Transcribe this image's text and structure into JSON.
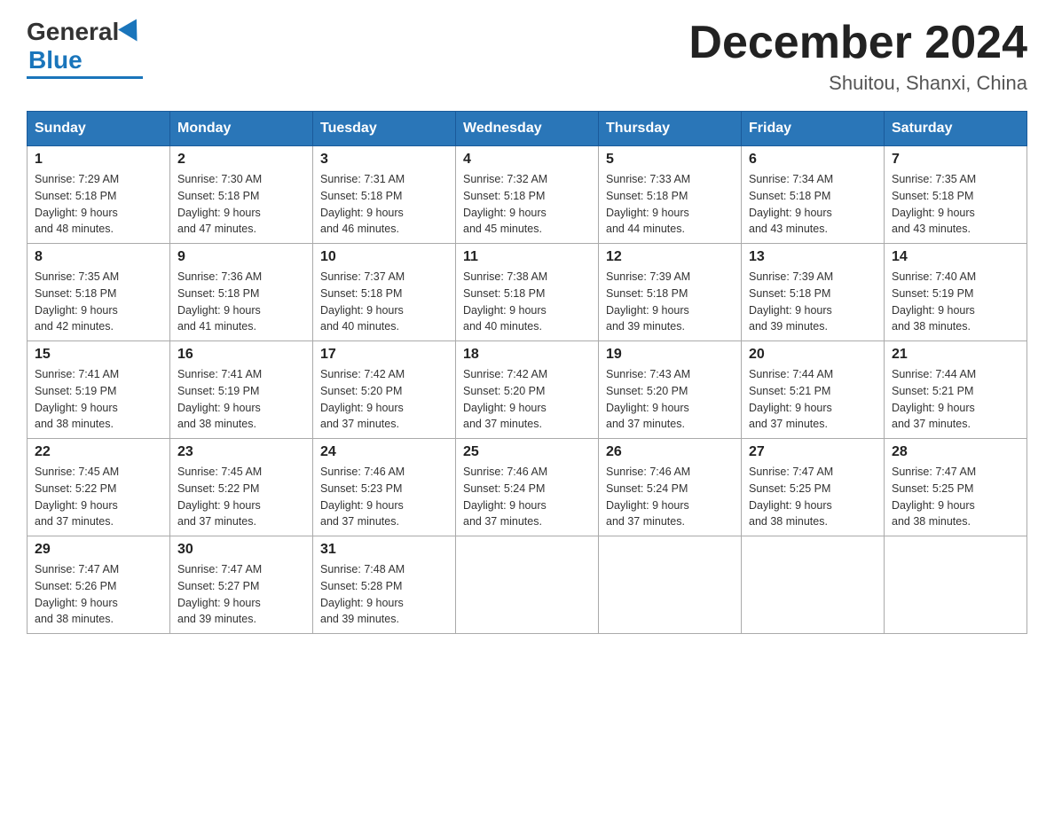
{
  "header": {
    "logo_general": "General",
    "logo_blue": "Blue",
    "main_title": "December 2024",
    "subtitle": "Shuitou, Shanxi, China"
  },
  "calendar": {
    "days_of_week": [
      "Sunday",
      "Monday",
      "Tuesday",
      "Wednesday",
      "Thursday",
      "Friday",
      "Saturday"
    ],
    "weeks": [
      [
        {
          "day": "1",
          "sunrise": "7:29 AM",
          "sunset": "5:18 PM",
          "daylight": "9 hours and 48 minutes."
        },
        {
          "day": "2",
          "sunrise": "7:30 AM",
          "sunset": "5:18 PM",
          "daylight": "9 hours and 47 minutes."
        },
        {
          "day": "3",
          "sunrise": "7:31 AM",
          "sunset": "5:18 PM",
          "daylight": "9 hours and 46 minutes."
        },
        {
          "day": "4",
          "sunrise": "7:32 AM",
          "sunset": "5:18 PM",
          "daylight": "9 hours and 45 minutes."
        },
        {
          "day": "5",
          "sunrise": "7:33 AM",
          "sunset": "5:18 PM",
          "daylight": "9 hours and 44 minutes."
        },
        {
          "day": "6",
          "sunrise": "7:34 AM",
          "sunset": "5:18 PM",
          "daylight": "9 hours and 43 minutes."
        },
        {
          "day": "7",
          "sunrise": "7:35 AM",
          "sunset": "5:18 PM",
          "daylight": "9 hours and 43 minutes."
        }
      ],
      [
        {
          "day": "8",
          "sunrise": "7:35 AM",
          "sunset": "5:18 PM",
          "daylight": "9 hours and 42 minutes."
        },
        {
          "day": "9",
          "sunrise": "7:36 AM",
          "sunset": "5:18 PM",
          "daylight": "9 hours and 41 minutes."
        },
        {
          "day": "10",
          "sunrise": "7:37 AM",
          "sunset": "5:18 PM",
          "daylight": "9 hours and 40 minutes."
        },
        {
          "day": "11",
          "sunrise": "7:38 AM",
          "sunset": "5:18 PM",
          "daylight": "9 hours and 40 minutes."
        },
        {
          "day": "12",
          "sunrise": "7:39 AM",
          "sunset": "5:18 PM",
          "daylight": "9 hours and 39 minutes."
        },
        {
          "day": "13",
          "sunrise": "7:39 AM",
          "sunset": "5:18 PM",
          "daylight": "9 hours and 39 minutes."
        },
        {
          "day": "14",
          "sunrise": "7:40 AM",
          "sunset": "5:19 PM",
          "daylight": "9 hours and 38 minutes."
        }
      ],
      [
        {
          "day": "15",
          "sunrise": "7:41 AM",
          "sunset": "5:19 PM",
          "daylight": "9 hours and 38 minutes."
        },
        {
          "day": "16",
          "sunrise": "7:41 AM",
          "sunset": "5:19 PM",
          "daylight": "9 hours and 38 minutes."
        },
        {
          "day": "17",
          "sunrise": "7:42 AM",
          "sunset": "5:20 PM",
          "daylight": "9 hours and 37 minutes."
        },
        {
          "day": "18",
          "sunrise": "7:42 AM",
          "sunset": "5:20 PM",
          "daylight": "9 hours and 37 minutes."
        },
        {
          "day": "19",
          "sunrise": "7:43 AM",
          "sunset": "5:20 PM",
          "daylight": "9 hours and 37 minutes."
        },
        {
          "day": "20",
          "sunrise": "7:44 AM",
          "sunset": "5:21 PM",
          "daylight": "9 hours and 37 minutes."
        },
        {
          "day": "21",
          "sunrise": "7:44 AM",
          "sunset": "5:21 PM",
          "daylight": "9 hours and 37 minutes."
        }
      ],
      [
        {
          "day": "22",
          "sunrise": "7:45 AM",
          "sunset": "5:22 PM",
          "daylight": "9 hours and 37 minutes."
        },
        {
          "day": "23",
          "sunrise": "7:45 AM",
          "sunset": "5:22 PM",
          "daylight": "9 hours and 37 minutes."
        },
        {
          "day": "24",
          "sunrise": "7:46 AM",
          "sunset": "5:23 PM",
          "daylight": "9 hours and 37 minutes."
        },
        {
          "day": "25",
          "sunrise": "7:46 AM",
          "sunset": "5:24 PM",
          "daylight": "9 hours and 37 minutes."
        },
        {
          "day": "26",
          "sunrise": "7:46 AM",
          "sunset": "5:24 PM",
          "daylight": "9 hours and 37 minutes."
        },
        {
          "day": "27",
          "sunrise": "7:47 AM",
          "sunset": "5:25 PM",
          "daylight": "9 hours and 38 minutes."
        },
        {
          "day": "28",
          "sunrise": "7:47 AM",
          "sunset": "5:25 PM",
          "daylight": "9 hours and 38 minutes."
        }
      ],
      [
        {
          "day": "29",
          "sunrise": "7:47 AM",
          "sunset": "5:26 PM",
          "daylight": "9 hours and 38 minutes."
        },
        {
          "day": "30",
          "sunrise": "7:47 AM",
          "sunset": "5:27 PM",
          "daylight": "9 hours and 39 minutes."
        },
        {
          "day": "31",
          "sunrise": "7:48 AM",
          "sunset": "5:28 PM",
          "daylight": "9 hours and 39 minutes."
        },
        null,
        null,
        null,
        null
      ]
    ],
    "sunrise_label": "Sunrise:",
    "sunset_label": "Sunset:",
    "daylight_label": "Daylight:"
  }
}
